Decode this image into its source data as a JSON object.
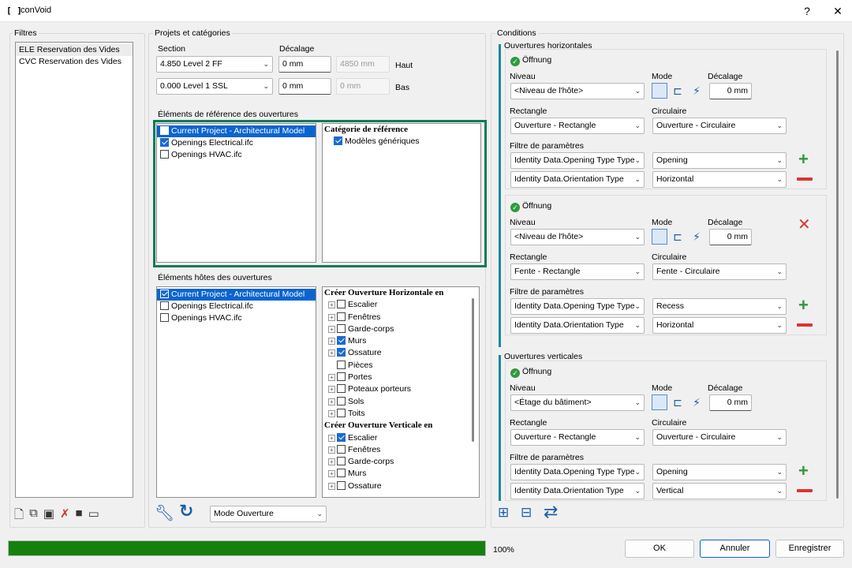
{
  "window": {
    "title": "conVoid",
    "help": "?",
    "close": "✕"
  },
  "filters": {
    "label": "Filtres",
    "items": [
      "ELE Reservation des Vides",
      "CVC Reservation des Vides"
    ]
  },
  "projects": {
    "label": "Projets et catégories",
    "section_label": "Section",
    "offset_label": "Décalage",
    "top": {
      "level": "4.850  Level 2 FF",
      "offset": "0 mm",
      "computed": "4850 mm",
      "suffix": "Haut"
    },
    "bottom": {
      "level": "0.000  Level 1 SSL",
      "offset": "0 mm",
      "computed": "0 mm",
      "suffix": "Bas"
    },
    "ref_label": "Éléments de référence des ouvertures",
    "ref_models": [
      {
        "name": "Current Project - Architectural Model",
        "checked": false,
        "selected": true
      },
      {
        "name": "Openings Electrical.ifc",
        "checked": true,
        "selected": false
      },
      {
        "name": "Openings HVAC.ifc",
        "checked": false,
        "selected": false
      }
    ],
    "ref_cat_header": "Catégorie de référence",
    "ref_cat_item": "Modèles génériques",
    "host_label": "Éléments hôtes des ouvertures",
    "host_models": [
      {
        "name": "Current Project - Architectural Model",
        "checked": true,
        "selected": true
      },
      {
        "name": "Openings Electrical.ifc",
        "checked": false,
        "selected": false
      },
      {
        "name": "Openings HVAC.ifc",
        "checked": false,
        "selected": false
      }
    ],
    "host_tree_h_header": "Créer Ouverture Horizontale en",
    "host_tree_h": [
      {
        "name": "Escalier",
        "checked": false,
        "exp": true
      },
      {
        "name": "Fenêtres",
        "checked": false,
        "exp": true
      },
      {
        "name": "Garde-corps",
        "checked": false,
        "exp": true
      },
      {
        "name": "Murs",
        "checked": true,
        "exp": true
      },
      {
        "name": "Ossature",
        "checked": true,
        "exp": true
      },
      {
        "name": "Pièces",
        "checked": false,
        "exp": false
      },
      {
        "name": "Portes",
        "checked": false,
        "exp": true
      },
      {
        "name": "Poteaux porteurs",
        "checked": false,
        "exp": true
      },
      {
        "name": "Sols",
        "checked": false,
        "exp": true
      },
      {
        "name": "Toits",
        "checked": false,
        "exp": true
      }
    ],
    "host_tree_v_header": "Créer Ouverture Verticale en",
    "host_tree_v": [
      {
        "name": "Escalier",
        "checked": true,
        "exp": true
      },
      {
        "name": "Fenêtres",
        "checked": false,
        "exp": true
      },
      {
        "name": "Garde-corps",
        "checked": false,
        "exp": true
      },
      {
        "name": "Murs",
        "checked": false,
        "exp": true
      },
      {
        "name": "Ossature",
        "checked": false,
        "exp": true
      }
    ],
    "mode": "Mode Ouverture"
  },
  "conditions": {
    "label": "Conditions",
    "horizontal_label": "Ouvertures horizontales",
    "vertical_label": "Ouvertures verticales",
    "blocks": [
      {
        "status": "Öffnung",
        "niveau": "<Niveau de l'hôte>",
        "offset": "0 mm",
        "rect": "Ouverture - Rectangle",
        "circ": "Ouverture - Circulaire",
        "p1": "Identity Data.Opening Type Type",
        "v1": "Opening",
        "p2": "Identity Data.Orientation Type",
        "v2": "Horizontal"
      },
      {
        "status": "Öffnung",
        "niveau": "<Niveau de l'hôte>",
        "offset": "0 mm",
        "rect": "Fente - Rectangle",
        "circ": "Fente - Circulaire",
        "p1": "Identity Data.Opening Type Type",
        "v1": "Recess",
        "p2": "Identity Data.Orientation Type",
        "v2": "Horizontal"
      },
      {
        "status": "Öffnung",
        "niveau": "<Étage du bâtiment>",
        "offset": "0 mm",
        "rect": "Ouverture - Rectangle",
        "circ": "Ouverture - Circulaire",
        "p1": "Identity Data.Opening Type Type",
        "v1": "Opening",
        "p2": "Identity Data.Orientation Type",
        "v2": "Vertical"
      }
    ],
    "labels": {
      "niveau": "Niveau",
      "mode": "Mode",
      "decalage": "Décalage",
      "rectangle": "Rectangle",
      "circulaire": "Circulaire",
      "filtre": "Filtre de paramètres"
    }
  },
  "footer": {
    "progress": 1.0,
    "progress_text": "100%",
    "ok": "OK",
    "cancel": "Annuler",
    "save": "Enregistrer"
  },
  "colors": {
    "accent": "#0a64d0",
    "progress": "#16800f",
    "highlight": "#0e7a5a",
    "ok_green": "#2e9a3e",
    "remove_red": "#dd3333"
  }
}
